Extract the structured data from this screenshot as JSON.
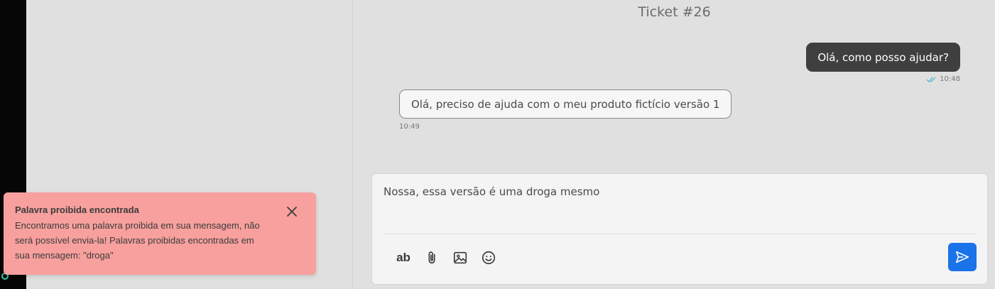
{
  "ticket": {
    "title": "Ticket #26"
  },
  "messages": {
    "outgoing": {
      "text": "Olá, como posso ajudar?",
      "time": "10:48"
    },
    "incoming": {
      "text": "Olá, preciso de ajuda com o meu produto fictício versão 1",
      "time": "10:49"
    }
  },
  "composer": {
    "value": "Nossa, essa versão é uma droga mesmo",
    "format_label": "ab",
    "icons": [
      "format-text-icon",
      "paperclip-icon",
      "image-icon",
      "emoji-icon",
      "send-icon"
    ]
  },
  "toast": {
    "title": "Palavra proibida encontrada",
    "body": "Encontramos uma palavra proibida em sua mensagem, não será possível envia-la! Palavras proibidas encontradas em sua mensagem: \"droga\""
  },
  "colors": {
    "send_button": "#1a73e8",
    "outgoing_bubble": "#3f3f3f",
    "toast_background": "#f7a09d",
    "read_check": "#3bb3d8"
  }
}
